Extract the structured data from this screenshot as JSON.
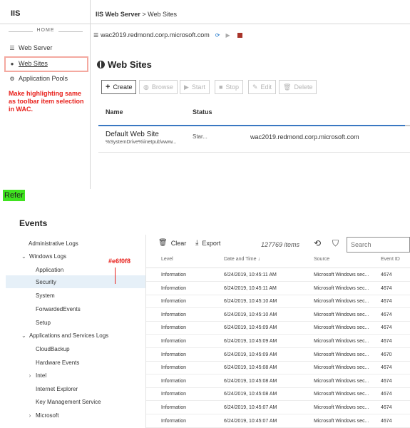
{
  "iis": {
    "title": "IIS",
    "home_label": "HOME",
    "nav": [
      {
        "label": "Web Server",
        "icon": "server-icon"
      },
      {
        "label": "Web Sites",
        "icon": "globe-icon"
      },
      {
        "label": "Application Pools",
        "icon": "gears-icon"
      }
    ],
    "note": "Make highlighting same as toolbar item selection in WAC.",
    "breadcrumb_root": "IIS Web Server",
    "breadcrumb_sep": " > ",
    "breadcrumb_page": "Web Sites",
    "server_name": "wac2019.redmond.corp.microsoft.com",
    "page_title": "Web Sites",
    "toolbar": {
      "create": "Create",
      "browse": "Browse",
      "start": "Start",
      "stop": "Stop",
      "edit": "Edit",
      "delete": "Delete"
    },
    "columns": {
      "name": "Name",
      "status": "Status"
    },
    "site": {
      "name": "Default Web Site",
      "path": "%SystemDrive%\\inetpub\\www...",
      "status": "Star...",
      "binding": "wac2019.redmond.corp.microsoft.com"
    },
    "colors": {
      "note": "#e8201b",
      "highlight_border": "#f4a9a0",
      "accent": "#3a78c2"
    }
  },
  "refer_label": "Refer",
  "events": {
    "title": "Events",
    "tree": [
      {
        "label": "Administrative Logs",
        "chevron": ""
      },
      {
        "label": "Windows Logs",
        "chevron": "v"
      },
      {
        "label": "Application",
        "chevron": ""
      },
      {
        "label": "Security",
        "chevron": ""
      },
      {
        "label": "System",
        "chevron": ""
      },
      {
        "label": "ForwardedEvents",
        "chevron": ""
      },
      {
        "label": "Setup",
        "chevron": ""
      },
      {
        "label": "Applications and Services Logs",
        "chevron": "v"
      },
      {
        "label": "CloudBackup",
        "chevron": ""
      },
      {
        "label": "Hardware Events",
        "chevron": ""
      },
      {
        "label": "Intel",
        "chevron": ">"
      },
      {
        "label": "Internet Explorer",
        "chevron": ""
      },
      {
        "label": "Key Management Service",
        "chevron": ""
      },
      {
        "label": "Microsoft",
        "chevron": ">"
      }
    ],
    "hex_note": "#e6f0f8",
    "clear_label": "Clear",
    "export_label": "Export",
    "item_count": "127769 items",
    "search_placeholder": "Search",
    "columns": {
      "level": "Level",
      "date": "Date and Time",
      "source": "Source",
      "event_id": "Event ID"
    },
    "rows": [
      {
        "level": "Information",
        "date": "6/24/2019, 10:45:11 AM",
        "source": "Microsoft Windows sec...",
        "id": "4674"
      },
      {
        "level": "Information",
        "date": "6/24/2019, 10:45:11 AM",
        "source": "Microsoft Windows sec...",
        "id": "4674"
      },
      {
        "level": "Information",
        "date": "6/24/2019, 10:45:10 AM",
        "source": "Microsoft Windows sec...",
        "id": "4674"
      },
      {
        "level": "Information",
        "date": "6/24/2019, 10:45:10 AM",
        "source": "Microsoft Windows sec...",
        "id": "4674"
      },
      {
        "level": "Information",
        "date": "6/24/2019, 10:45:09 AM",
        "source": "Microsoft Windows sec...",
        "id": "4674"
      },
      {
        "level": "Information",
        "date": "6/24/2019, 10:45:09 AM",
        "source": "Microsoft Windows sec...",
        "id": "4674"
      },
      {
        "level": "Information",
        "date": "6/24/2019, 10:45:09 AM",
        "source": "Microsoft Windows sec...",
        "id": "4670"
      },
      {
        "level": "Information",
        "date": "6/24/2019, 10:45:08 AM",
        "source": "Microsoft Windows sec...",
        "id": "4674"
      },
      {
        "level": "Information",
        "date": "6/24/2019, 10:45:08 AM",
        "source": "Microsoft Windows sec...",
        "id": "4674"
      },
      {
        "level": "Information",
        "date": "6/24/2019, 10:45:08 AM",
        "source": "Microsoft Windows sec...",
        "id": "4674"
      },
      {
        "level": "Information",
        "date": "6/24/2019, 10:45:07 AM",
        "source": "Microsoft Windows sec...",
        "id": "4674"
      },
      {
        "level": "Information",
        "date": "6/24/2019, 10:45:07 AM",
        "source": "Microsoft Windows sec...",
        "id": "4674"
      },
      {
        "level": "Information",
        "date": "6/24/2019, 10:45:06 AM",
        "source": "Microsoft Windows sec...",
        "id": "4674"
      }
    ],
    "colors": {
      "selected_row": "#e6f0f8",
      "note": "#e8201b"
    }
  }
}
